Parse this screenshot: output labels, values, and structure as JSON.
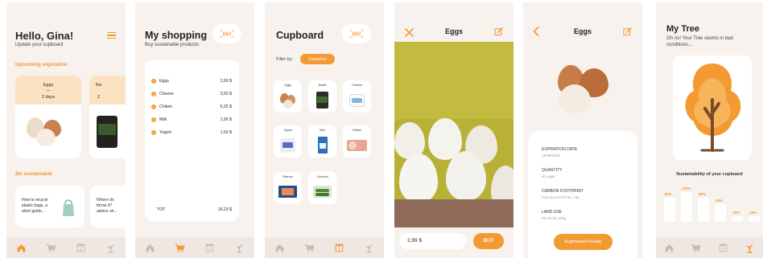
{
  "screen1": {
    "greeting": "Hello, Gina!",
    "subtitle": "Update your cupboard",
    "section_expiration": "Upcoming expiration",
    "exp_items": [
      {
        "name": "Eggs",
        "dash": "—",
        "days": "2 days"
      },
      {
        "name": "Ra",
        "days": "2"
      }
    ],
    "section_sustainable": "Be sustainable",
    "tips": [
      {
        "text": "How to recycle plastic bags, a short guide..."
      },
      {
        "text": "Where do throw it? advice on..."
      }
    ]
  },
  "screen2": {
    "title": "My shopping",
    "subtitle": "Buy sustainable products",
    "items": [
      {
        "name": "Eggs",
        "price": "2,99 $"
      },
      {
        "name": "Cheese",
        "price": "3,50 $"
      },
      {
        "name": "Chiken",
        "price": "6,25 $"
      },
      {
        "name": "Milk",
        "price": "1,99 $"
      },
      {
        "name": "Yogurt",
        "price": "1,50 $"
      }
    ],
    "total_label": "TOT",
    "total_value": "16,23 $"
  },
  "screen3": {
    "title": "Cupboard",
    "filter_label": "Filter by:",
    "filter_value": "Expiration",
    "tiles": [
      "Eggs",
      "Nutell",
      "Cheese",
      "Yogurt",
      "Milk",
      "Chiken",
      "Salmon",
      "Zucchini"
    ]
  },
  "screen4": {
    "title": "Eggs",
    "price": "2,99 $",
    "buy_label": "BUY"
  },
  "screen5": {
    "title": "Eggs",
    "details": [
      {
        "label": "EXPIRATION DATE",
        "value": "15/09/2020"
      },
      {
        "label": "QUANTITY",
        "value": "six eggs"
      },
      {
        "label": "CARBON FOOTPRINT",
        "value": "0,04 kg of CO2 for 1 kg"
      },
      {
        "label": "LAND USE",
        "value": "25 m2 for 100g"
      }
    ],
    "ar_button": "Augmented Reality"
  },
  "screen6": {
    "title": "My Tree",
    "subtitle": "Oh no! Your Tree seems in bad conditions...",
    "chart_title": "Sustainability of your cupboard"
  },
  "chart_data": {
    "type": "bar",
    "title": "Sustainability of your cupboard",
    "categories": [
      "",
      "",
      "",
      "",
      "",
      ""
    ],
    "values": [
      80,
      100,
      80,
      60,
      20,
      20
    ],
    "value_labels": [
      "80%",
      "100%",
      "80%",
      "60%",
      "20%",
      "20%"
    ],
    "ylim": [
      0,
      100
    ],
    "grid": false
  },
  "colors": {
    "accent": "#f39a32",
    "background": "#f7f2ee",
    "card": "#ffffff",
    "nav": "#efe8e2"
  },
  "nav_icons": [
    "home-icon",
    "cart-icon",
    "cupboard-icon",
    "tree-icon"
  ]
}
